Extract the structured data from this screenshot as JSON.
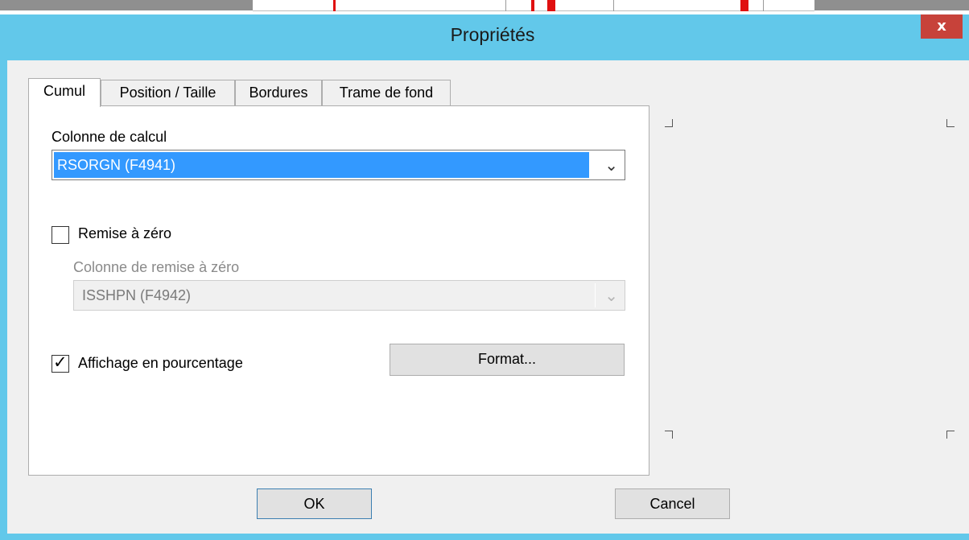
{
  "window": {
    "title": "Propriétés",
    "close_label": "x",
    "accent_color": "#62c8ea"
  },
  "tabs": [
    {
      "label": "Cumul",
      "active": true
    },
    {
      "label": "Position / Taille",
      "active": false
    },
    {
      "label": "Bordures",
      "active": false
    },
    {
      "label": "Trame de fond",
      "active": false
    }
  ],
  "cumul": {
    "calc_column_label": "Colonne de calcul",
    "calc_column_value": "RSORGN (F4941)",
    "reset_label": "Remise à zéro",
    "reset_checked": false,
    "reset_column_label": "Colonne de remise à zéro",
    "reset_column_value": "ISSHPN (F4942)",
    "percent_label": "Affichage en pourcentage",
    "percent_checked": true,
    "format_button": "Format..."
  },
  "buttons": {
    "ok": "OK",
    "cancel": "Cancel"
  },
  "icons": {
    "close": "close-icon",
    "dropdown": "chevron-down-icon",
    "check": "checkmark-icon"
  }
}
